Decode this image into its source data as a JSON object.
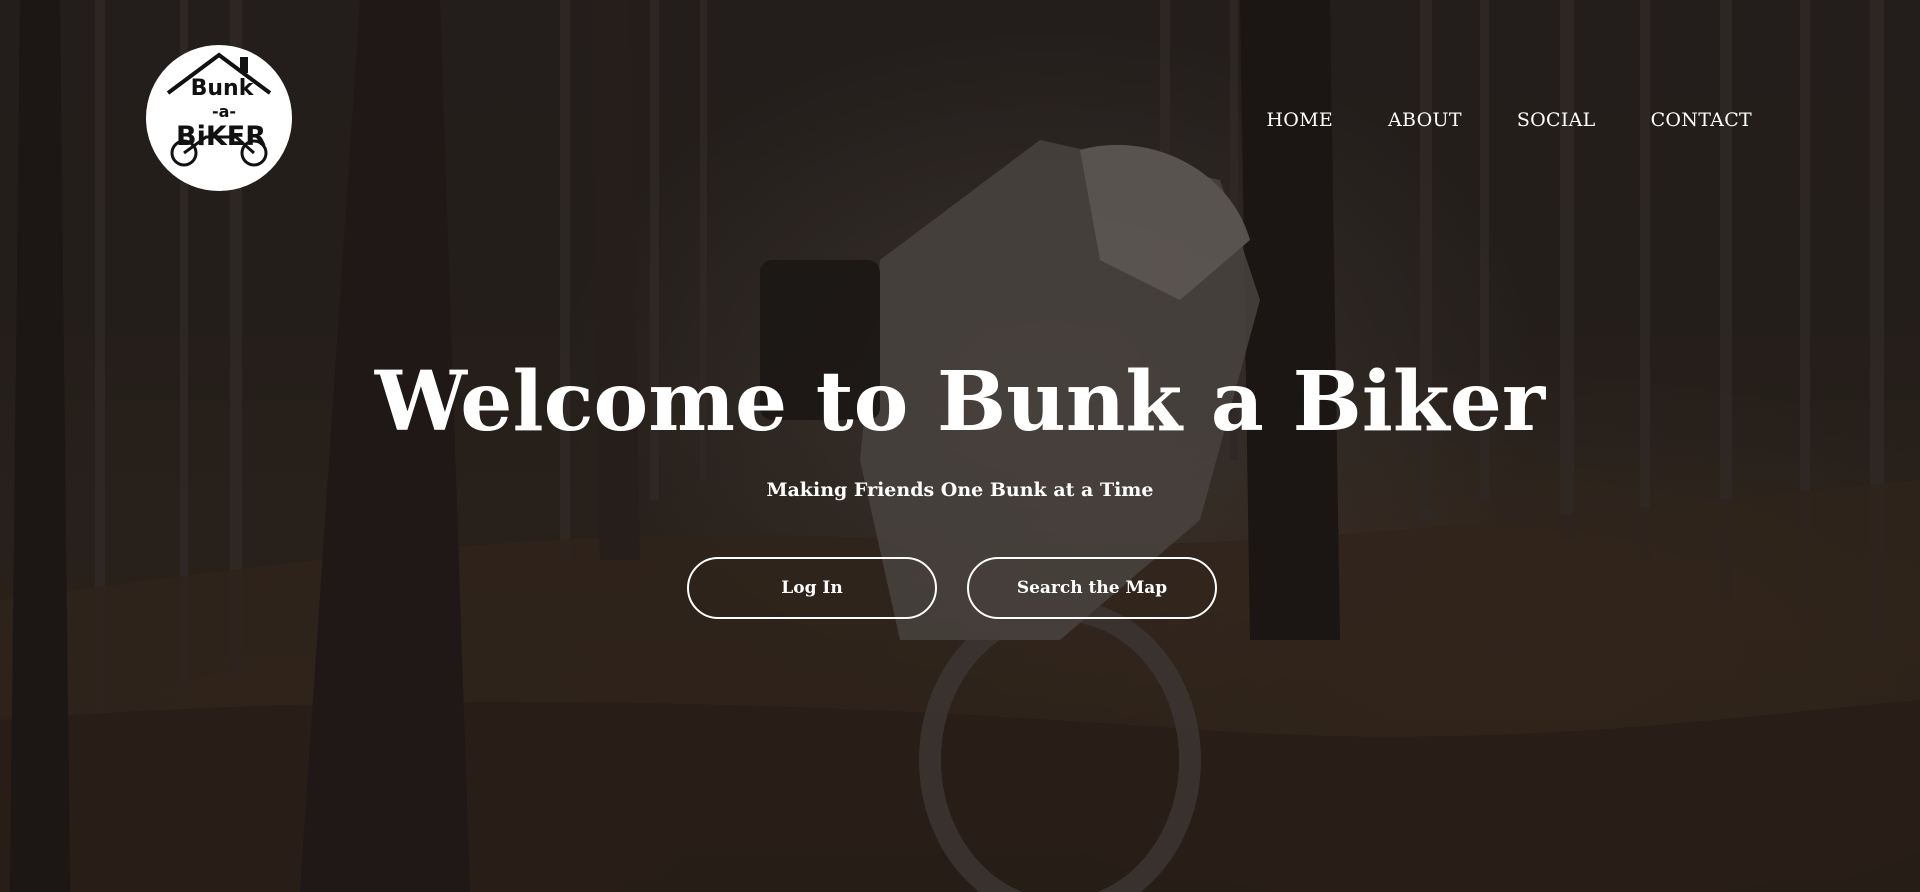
{
  "header": {
    "logo": {
      "line1": "Bunk",
      "line2": "-a-",
      "line3": "BiKER",
      "icon": "bunk-a-biker-logo"
    },
    "nav": [
      {
        "label": "HOME"
      },
      {
        "label": "ABOUT"
      },
      {
        "label": "SOCIAL"
      },
      {
        "label": "CONTACT"
      }
    ]
  },
  "hero": {
    "title": "Welcome to Bunk a Biker",
    "subtitle": "Making Friends One Bunk at a Time",
    "buttons": {
      "login": "Log In",
      "search_map": "Search the Map"
    }
  },
  "colors": {
    "text": "#ffffff",
    "background": "#2a2422",
    "logo_bg": "#ffffff",
    "logo_ink": "#111111"
  }
}
